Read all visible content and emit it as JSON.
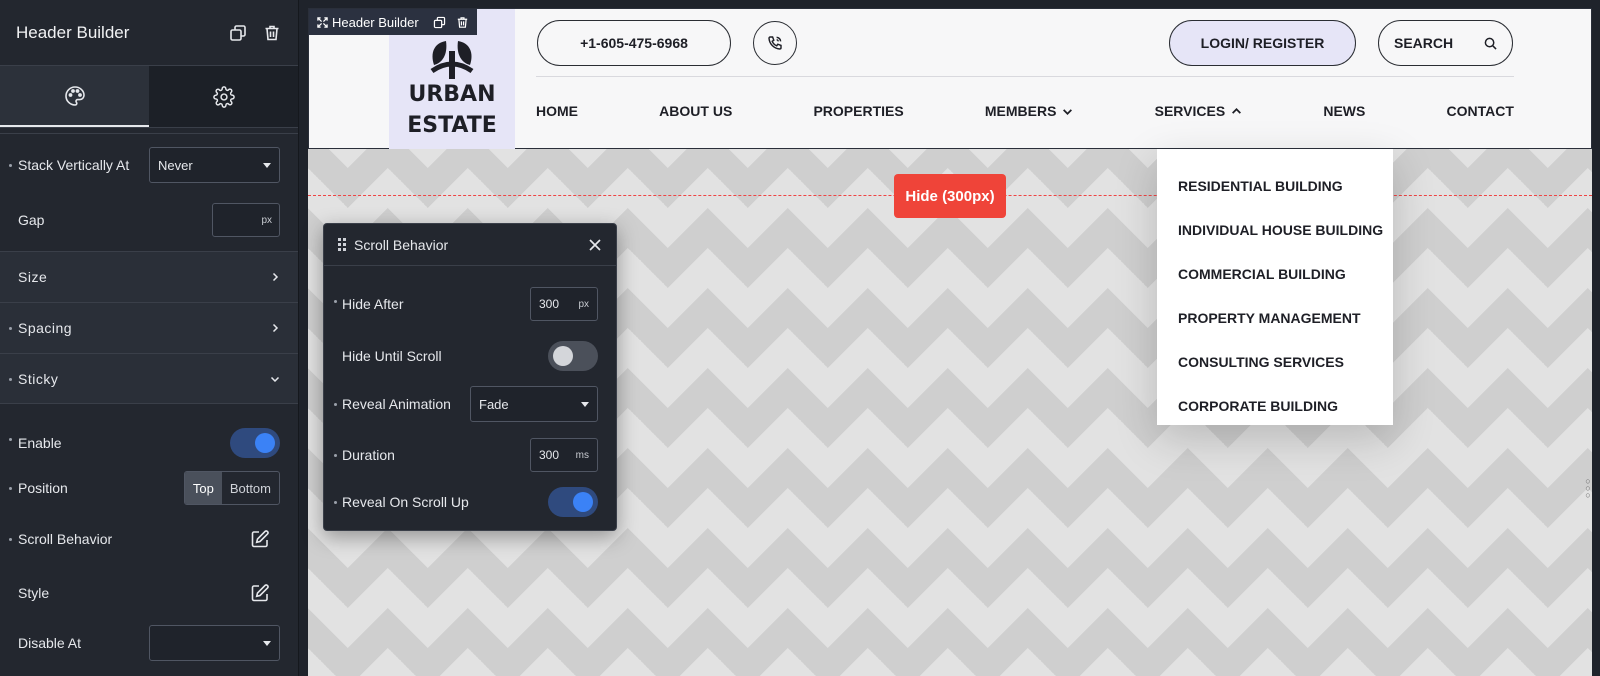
{
  "panel": {
    "title": "Header Builder",
    "tabs": {
      "style": "palette-icon",
      "settings": "gear-icon"
    },
    "stack_vertically_label": "Stack Vertically At",
    "stack_vertically_value": "Never",
    "gap_label": "Gap",
    "gap_value": "",
    "gap_unit": "px",
    "sections": {
      "size": "Size",
      "spacing": "Spacing",
      "sticky": "Sticky"
    },
    "enable_label": "Enable",
    "enable_on": true,
    "position_label": "Position",
    "position_options": [
      "Top",
      "Bottom"
    ],
    "position_selected": "Top",
    "scroll_behavior_label": "Scroll Behavior",
    "style_label": "Style",
    "disable_at_label": "Disable At",
    "disable_at_value": ""
  },
  "canvas": {
    "builder_label": "Header Builder",
    "logo_line1": "URBAN",
    "logo_line2": "ESTATE",
    "phone": "+1-605-475-6968",
    "login": "LOGIN/ REGISTER",
    "search": "SEARCH",
    "nav": [
      "HOME",
      "ABOUT US",
      "PROPERTIES",
      "MEMBERS",
      "SERVICES",
      "NEWS",
      "CONTACT"
    ],
    "hide_badge": "Hide (300px)",
    "services_dropdown": [
      "RESIDENTIAL BUILDING",
      "INDIVIDUAL HOUSE BUILDING",
      "COMMERCIAL BUILDING",
      "PROPERTY MANAGEMENT",
      "CONSULTING SERVICES",
      "CORPORATE BUILDING"
    ]
  },
  "popup": {
    "title": "Scroll Behavior",
    "hide_after_label": "Hide After",
    "hide_after_value": "300",
    "hide_after_unit": "px",
    "hide_until_scroll_label": "Hide Until Scroll",
    "hide_until_scroll_on": false,
    "reveal_animation_label": "Reveal Animation",
    "reveal_animation_value": "Fade",
    "duration_label": "Duration",
    "duration_value": "300",
    "duration_unit": "ms",
    "reveal_on_scroll_up_label": "Reveal On Scroll Up",
    "reveal_on_scroll_up_on": true
  },
  "colors": {
    "panel_bg": "#23272f",
    "accent_blue": "#3b82f6",
    "hide_red": "#ef4439",
    "logo_bg": "#e6e5f7"
  }
}
